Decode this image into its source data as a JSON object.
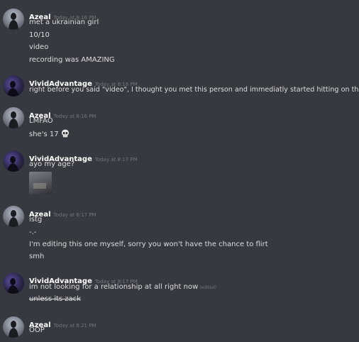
{
  "messages": [
    {
      "author": "Azeal",
      "time": "Today at 8:16 PM",
      "lines": [
        "met a ukrainian girl",
        "10/10",
        "video",
        "recording was AMAZING"
      ]
    },
    {
      "author": "VividAdvantage",
      "time": "Today at 8:16 PM",
      "lines": [
        "right before you said \"video\", I thought you met this person and immediatly started hitting on them"
      ]
    },
    {
      "author": "Azeal",
      "time": "Today at 8:16 PM",
      "lines": [
        "LMFAO",
        "she's 17"
      ],
      "emoji": "skull-emoji"
    },
    {
      "author": "VividAdvantage",
      "time": "Today at 8:17 PM",
      "lines": [
        "ayo my age?"
      ],
      "attachment": "image-thumbnail"
    },
    {
      "author": "Azeal",
      "time": "Today at 8:17 PM",
      "lines": [
        "istg",
        "-.-",
        "I'm editing this one myself, sorry you won't have the chance to flirt",
        "smh"
      ]
    },
    {
      "author": "VividAdvantage",
      "time": "Today at 8:17 PM",
      "lines": [
        "im not looking for a relationship at all right now",
        "unless its zack"
      ],
      "edited_label": "(edited)"
    },
    {
      "author": "Azeal",
      "time": "Today at 8:21 PM",
      "lines": [
        "OOP"
      ]
    }
  ],
  "colors": {
    "background": "#36393f",
    "username": "#ffffff",
    "timestamp": "#72767d",
    "text": "#dcddde"
  }
}
